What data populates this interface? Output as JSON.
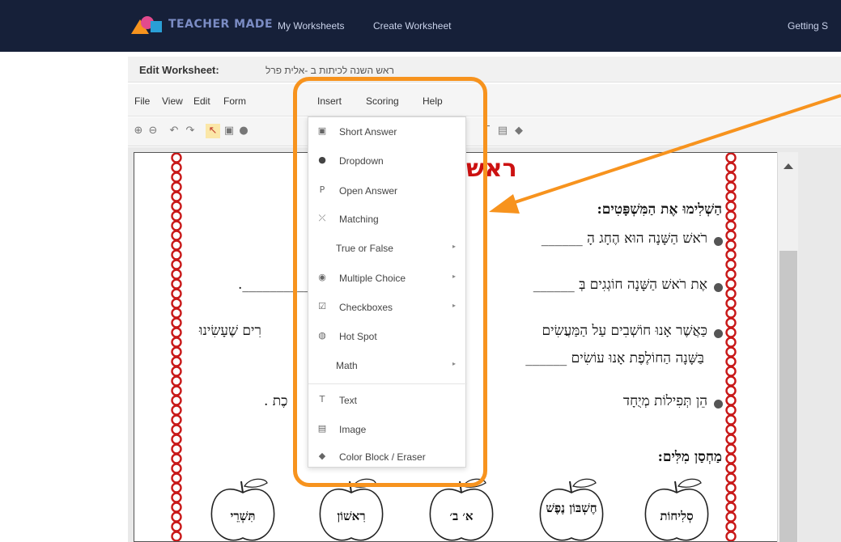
{
  "nav": {
    "brand": "TEACHER MADE",
    "links": [
      "My Worksheets",
      "Create Worksheet"
    ],
    "right": "Getting S"
  },
  "editor": {
    "label": "Edit Worksheet:",
    "worksheet_name": "ראש השנה לכיתות ב -אלית פרל"
  },
  "menu": [
    "File",
    "View",
    "Edit",
    "Form",
    "Insert",
    "Scoring",
    "Help"
  ],
  "toolbar_icons": [
    "zoom-in-icon",
    "zoom-out-icon",
    "undo-icon",
    "redo-icon",
    "select-arrow-icon",
    "short-answer-tool-icon",
    "dropdown-tool-icon",
    "text-tool-icon",
    "image-tool-icon",
    "eraser-tool-icon"
  ],
  "insert_menu": {
    "items": [
      {
        "label": "Short Answer",
        "icon": "short-answer-icon",
        "submenu": false
      },
      {
        "label": "Dropdown",
        "icon": "dropdown-icon",
        "submenu": false
      },
      {
        "label": "Open Answer",
        "icon": "open-answer-icon",
        "submenu": false
      },
      {
        "label": "Matching",
        "icon": "matching-icon",
        "submenu": false
      },
      {
        "label": "True or False",
        "icon": "",
        "submenu": true
      },
      {
        "label": "Multiple Choice",
        "icon": "multiple-choice-icon",
        "submenu": true
      },
      {
        "label": "Checkboxes",
        "icon": "checkbox-icon",
        "submenu": true
      },
      {
        "label": "Hot Spot",
        "icon": "hot-spot-icon",
        "submenu": false
      },
      {
        "label": "Math",
        "icon": "",
        "submenu": true
      },
      {
        "label": "Text",
        "icon": "text-icon",
        "submenu": false
      },
      {
        "label": "Image",
        "icon": "image-icon",
        "submenu": false
      },
      {
        "label": "Color Block / Eraser",
        "icon": "eraser-icon",
        "submenu": false
      }
    ]
  },
  "worksheet": {
    "title": "ראש",
    "instruction": "הַשְׁלִימוּ אֶת הַמִּשְׁפָּטִים:",
    "sentences": [
      "רֹאשׁ הַשָּׁנָה הוּא הֶחָג הָ ______",
      "אֶת רֹאשׁ הַשָּׁנָה חוֹגְגִים בְּ ______",
      "כַּאֲשֶׁר אָנוּ חוֹשְׁבִים עַל הַמַּעֲשִׂים",
      "רִים שֶׁעָשִׂינוּ",
      "בַּשָּׁנָה הַחוֹלֶפֶת אָנוּ עוֹשִׂים ______",
      "הֵן תְּפִילוֹת מְיֻחָד",
      "כֶת ."
    ],
    "word_bank_title": "מַחְסַן מִלִּים:",
    "word_bank": [
      "סְלִיחוֹת",
      "חֶשְׁבּוֹן נֶפֶשׁ",
      "א׳ ב׳",
      "רִאשׁוֹן",
      "תִּשְׁרֵי"
    ]
  },
  "colors": {
    "nav_bg": "#162039",
    "highlight": "#f7931e",
    "title_red": "#cc1111"
  }
}
